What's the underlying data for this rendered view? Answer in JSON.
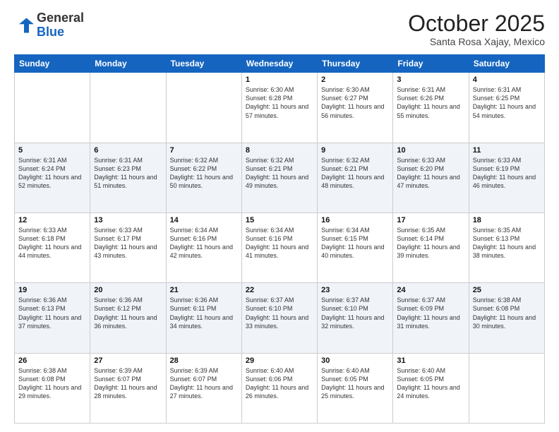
{
  "header": {
    "logo_general": "General",
    "logo_blue": "Blue",
    "month_title": "October 2025",
    "location": "Santa Rosa Xajay, Mexico"
  },
  "days_of_week": [
    "Sunday",
    "Monday",
    "Tuesday",
    "Wednesday",
    "Thursday",
    "Friday",
    "Saturday"
  ],
  "weeks": [
    [
      {
        "day": "",
        "info": ""
      },
      {
        "day": "",
        "info": ""
      },
      {
        "day": "",
        "info": ""
      },
      {
        "day": "1",
        "info": "Sunrise: 6:30 AM\nSunset: 6:28 PM\nDaylight: 11 hours and 57 minutes."
      },
      {
        "day": "2",
        "info": "Sunrise: 6:30 AM\nSunset: 6:27 PM\nDaylight: 11 hours and 56 minutes."
      },
      {
        "day": "3",
        "info": "Sunrise: 6:31 AM\nSunset: 6:26 PM\nDaylight: 11 hours and 55 minutes."
      },
      {
        "day": "4",
        "info": "Sunrise: 6:31 AM\nSunset: 6:25 PM\nDaylight: 11 hours and 54 minutes."
      }
    ],
    [
      {
        "day": "5",
        "info": "Sunrise: 6:31 AM\nSunset: 6:24 PM\nDaylight: 11 hours and 52 minutes."
      },
      {
        "day": "6",
        "info": "Sunrise: 6:31 AM\nSunset: 6:23 PM\nDaylight: 11 hours and 51 minutes."
      },
      {
        "day": "7",
        "info": "Sunrise: 6:32 AM\nSunset: 6:22 PM\nDaylight: 11 hours and 50 minutes."
      },
      {
        "day": "8",
        "info": "Sunrise: 6:32 AM\nSunset: 6:21 PM\nDaylight: 11 hours and 49 minutes."
      },
      {
        "day": "9",
        "info": "Sunrise: 6:32 AM\nSunset: 6:21 PM\nDaylight: 11 hours and 48 minutes."
      },
      {
        "day": "10",
        "info": "Sunrise: 6:33 AM\nSunset: 6:20 PM\nDaylight: 11 hours and 47 minutes."
      },
      {
        "day": "11",
        "info": "Sunrise: 6:33 AM\nSunset: 6:19 PM\nDaylight: 11 hours and 46 minutes."
      }
    ],
    [
      {
        "day": "12",
        "info": "Sunrise: 6:33 AM\nSunset: 6:18 PM\nDaylight: 11 hours and 44 minutes."
      },
      {
        "day": "13",
        "info": "Sunrise: 6:33 AM\nSunset: 6:17 PM\nDaylight: 11 hours and 43 minutes."
      },
      {
        "day": "14",
        "info": "Sunrise: 6:34 AM\nSunset: 6:16 PM\nDaylight: 11 hours and 42 minutes."
      },
      {
        "day": "15",
        "info": "Sunrise: 6:34 AM\nSunset: 6:16 PM\nDaylight: 11 hours and 41 minutes."
      },
      {
        "day": "16",
        "info": "Sunrise: 6:34 AM\nSunset: 6:15 PM\nDaylight: 11 hours and 40 minutes."
      },
      {
        "day": "17",
        "info": "Sunrise: 6:35 AM\nSunset: 6:14 PM\nDaylight: 11 hours and 39 minutes."
      },
      {
        "day": "18",
        "info": "Sunrise: 6:35 AM\nSunset: 6:13 PM\nDaylight: 11 hours and 38 minutes."
      }
    ],
    [
      {
        "day": "19",
        "info": "Sunrise: 6:36 AM\nSunset: 6:13 PM\nDaylight: 11 hours and 37 minutes."
      },
      {
        "day": "20",
        "info": "Sunrise: 6:36 AM\nSunset: 6:12 PM\nDaylight: 11 hours and 36 minutes."
      },
      {
        "day": "21",
        "info": "Sunrise: 6:36 AM\nSunset: 6:11 PM\nDaylight: 11 hours and 34 minutes."
      },
      {
        "day": "22",
        "info": "Sunrise: 6:37 AM\nSunset: 6:10 PM\nDaylight: 11 hours and 33 minutes."
      },
      {
        "day": "23",
        "info": "Sunrise: 6:37 AM\nSunset: 6:10 PM\nDaylight: 11 hours and 32 minutes."
      },
      {
        "day": "24",
        "info": "Sunrise: 6:37 AM\nSunset: 6:09 PM\nDaylight: 11 hours and 31 minutes."
      },
      {
        "day": "25",
        "info": "Sunrise: 6:38 AM\nSunset: 6:08 PM\nDaylight: 11 hours and 30 minutes."
      }
    ],
    [
      {
        "day": "26",
        "info": "Sunrise: 6:38 AM\nSunset: 6:08 PM\nDaylight: 11 hours and 29 minutes."
      },
      {
        "day": "27",
        "info": "Sunrise: 6:39 AM\nSunset: 6:07 PM\nDaylight: 11 hours and 28 minutes."
      },
      {
        "day": "28",
        "info": "Sunrise: 6:39 AM\nSunset: 6:07 PM\nDaylight: 11 hours and 27 minutes."
      },
      {
        "day": "29",
        "info": "Sunrise: 6:40 AM\nSunset: 6:06 PM\nDaylight: 11 hours and 26 minutes."
      },
      {
        "day": "30",
        "info": "Sunrise: 6:40 AM\nSunset: 6:05 PM\nDaylight: 11 hours and 25 minutes."
      },
      {
        "day": "31",
        "info": "Sunrise: 6:40 AM\nSunset: 6:05 PM\nDaylight: 11 hours and 24 minutes."
      },
      {
        "day": "",
        "info": ""
      }
    ]
  ]
}
